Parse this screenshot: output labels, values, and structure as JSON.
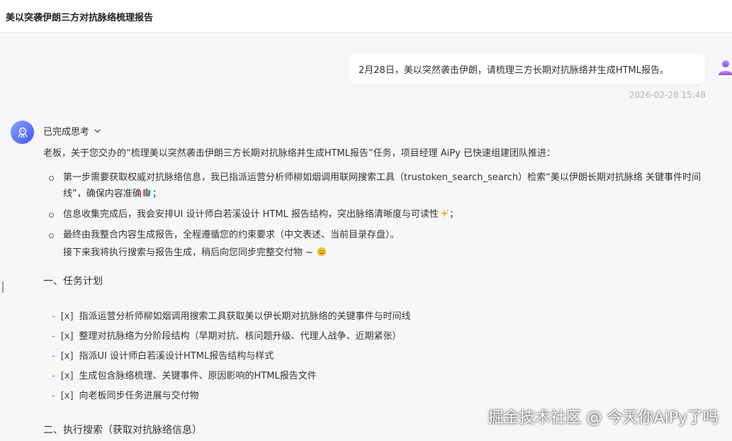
{
  "header": {
    "title": "美以突袭伊朗三方对抗脉络梳理报告"
  },
  "user_message": {
    "text": "2月28日，美以突然袭击伊朗，请梳理三方长期对抗脉络并生成HTML报告。",
    "time": "2026-02-28 15:48"
  },
  "assistant": {
    "thinking_label": "已完成思考",
    "intro": "老板，关于您交办的“梳理美以突然袭击伊朗三方长期对抗脉络并生成HTML报告”任务，项目经理 AiPy 已快速组建团队推进：",
    "bullets": [
      {
        "text": "第一步需要获取权威对抗脉络信息，我已指派运营分析师柳如烟调用联网搜索工具（trustoken_search_search）检索“美以伊朗长期对抗脉络 关键事件时间线”，确保内容准确",
        "tail": "；",
        "emoji": "books-emoji"
      },
      {
        "text": "信息收集完成后，我会安排UI 设计师白若溪设计 HTML 报告结构，突出脉络清晰度与可读性",
        "tail": "；",
        "emoji": "sparkles-emoji"
      },
      {
        "text": "最终由我整合内容生成报告，全程遵循您的约束要求（中文表述、当前目录存盘）。",
        "tail": "",
        "emoji": ""
      }
    ],
    "followup": "接下来我将执行搜索与报告生成，稍后向您同步完整交付物 ~",
    "section1_title": "一、任务计划",
    "tasks": [
      "指派运营分析师柳如烟调用搜索工具获取美以伊长期对抗脉络的关键事件与时间线",
      "整理对抗脉络为分阶段结构（早期对抗、核问题升级、代理人战争、近期紧张）",
      "指派UI 设计师白若溪设计HTML报告结构与样式",
      "生成包含脉络梳理、关键事件、原因影响的HTML报告文件",
      "向老板同步任务进展与交付物"
    ],
    "task_dash": "-",
    "task_checkbox": "[x]",
    "section2_title": "二、执行搜索（获取对抗脉络信息）"
  },
  "watermark": "掘金技术社区 @ 今天你AiPy了吗",
  "colors": {
    "accent": "#3b86d6",
    "background": "#f7f7f9",
    "bubble": "#ffffff"
  }
}
